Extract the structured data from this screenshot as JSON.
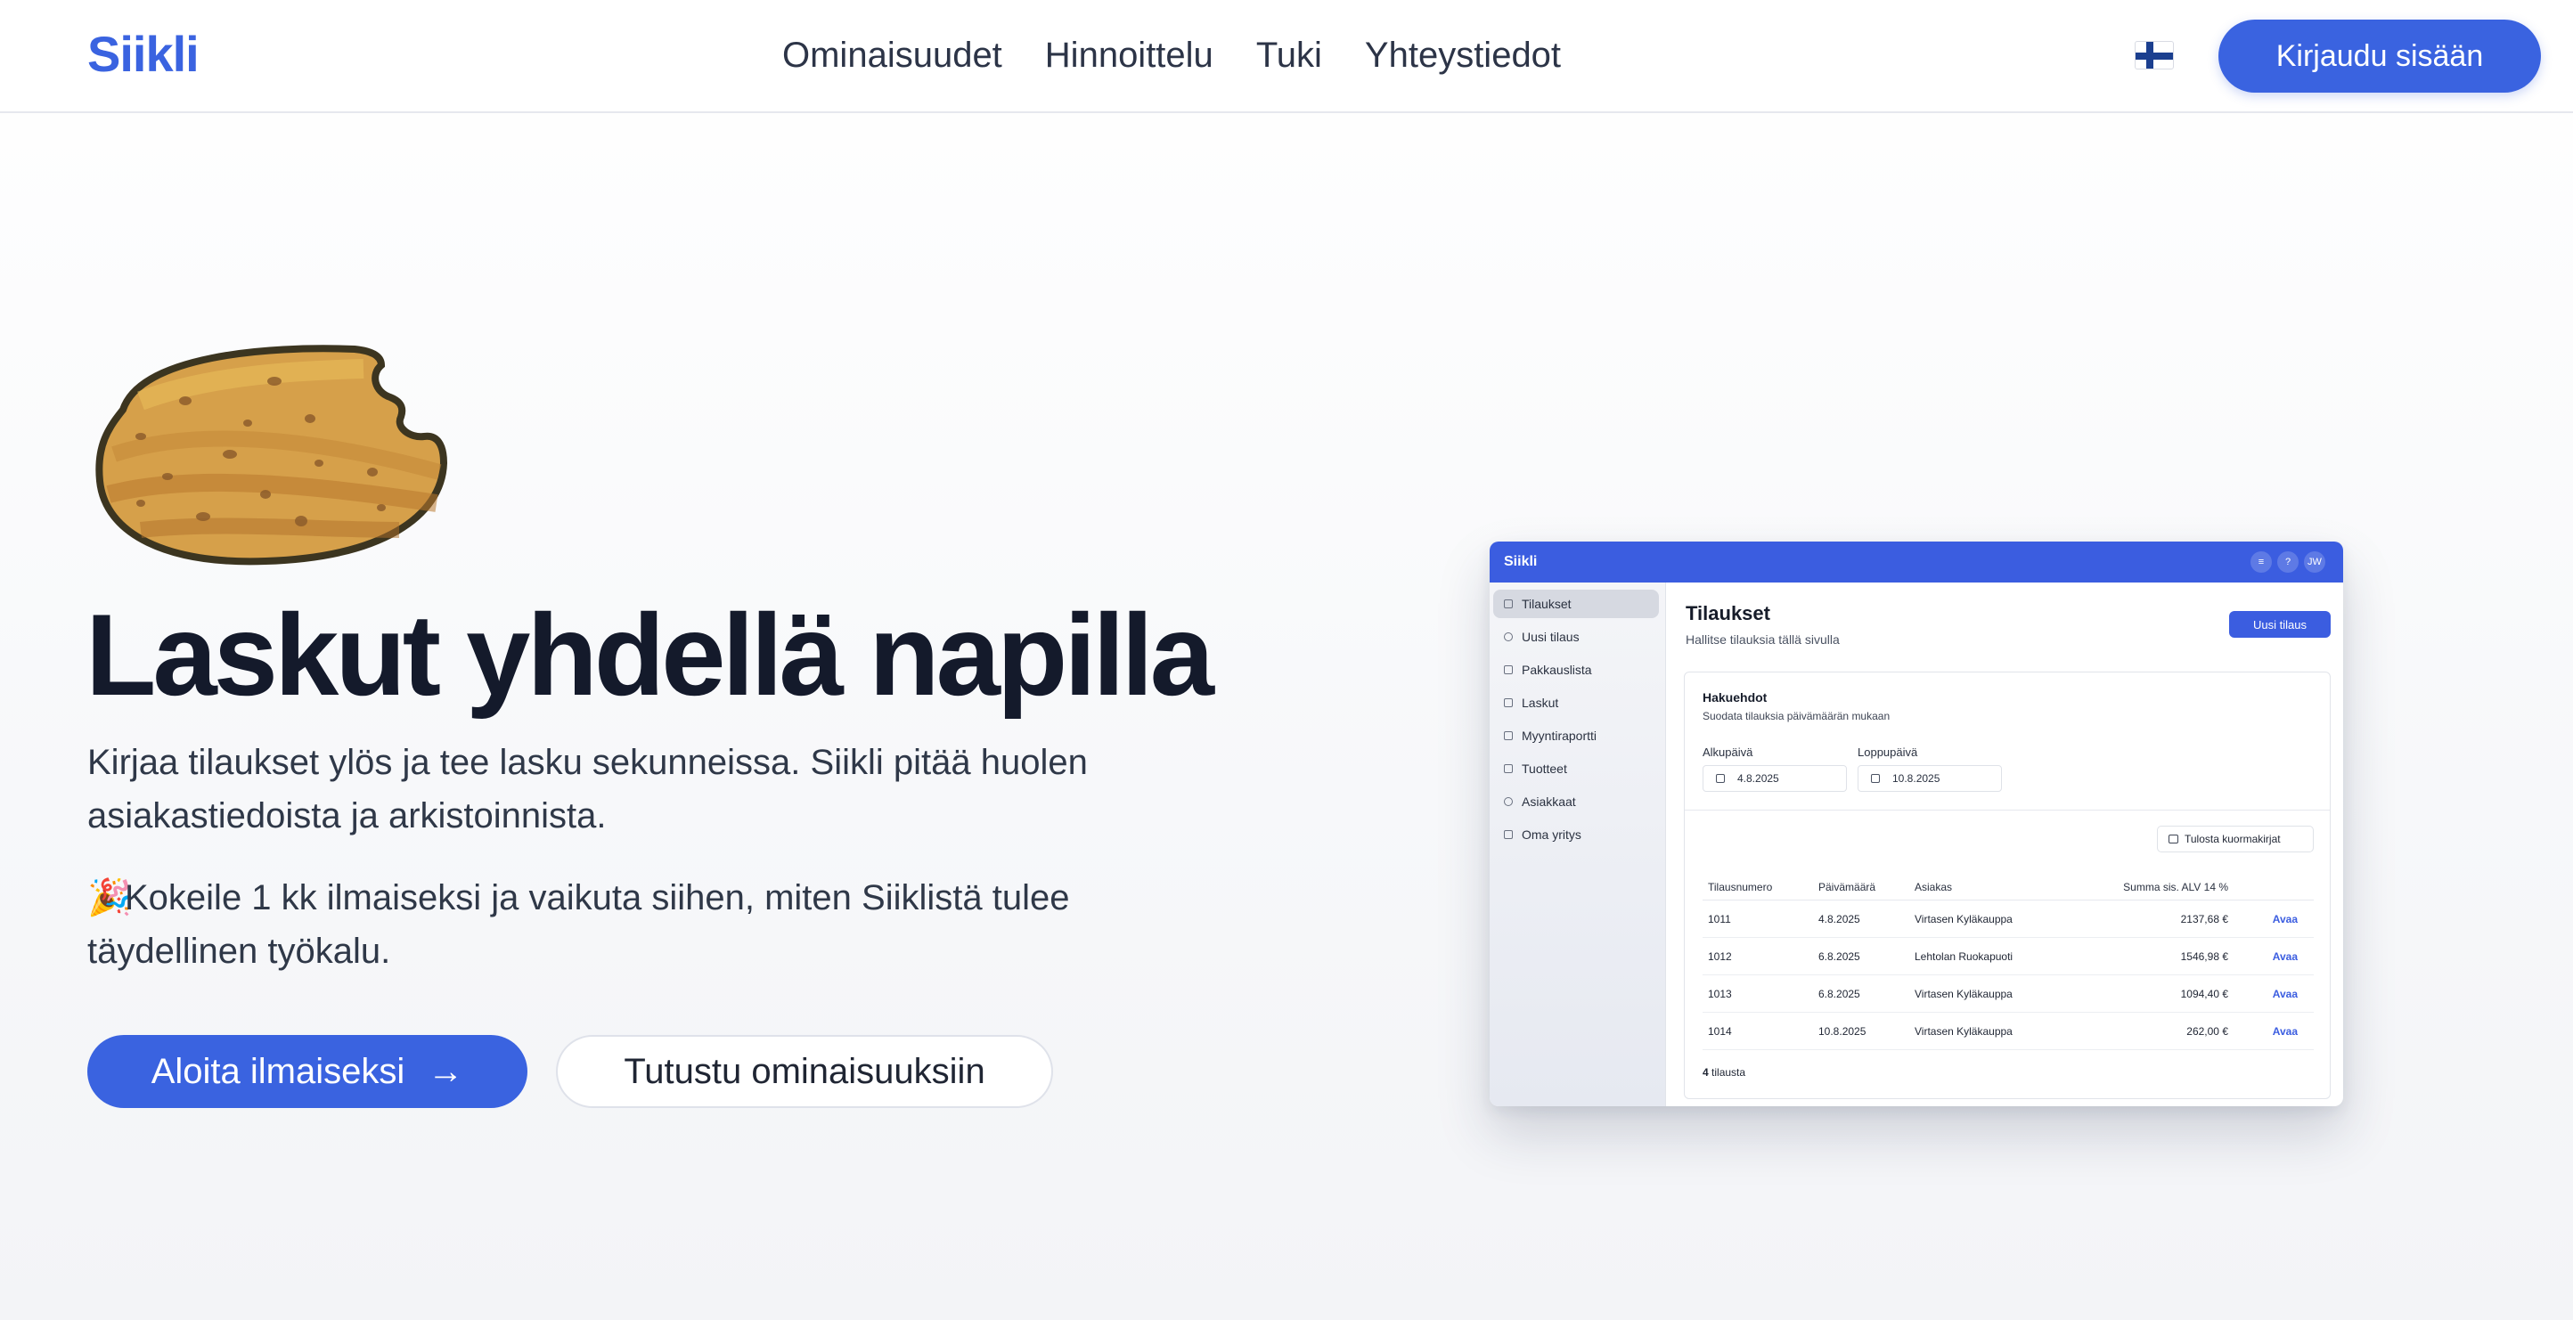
{
  "header": {
    "logo": "Siikli",
    "nav": [
      "Ominaisuudet",
      "Hinnoittelu",
      "Tuki",
      "Yhteystiedot"
    ],
    "language_icon": "finnish-flag-icon",
    "login_label": "Kirjaudu sisään"
  },
  "hero": {
    "mascot_icon": "bitten-potato-icon",
    "title": "Laskut yhdellä napilla",
    "text1": "Kirjaa tilaukset ylös ja tee lasku sekunneissa. Siikli pitää huolen asiakastiedoista ja arkistoinnista.",
    "text2_emoji": "🎉",
    "text2": "Kokeile 1 kk ilmaiseksi ja vaikuta siihen, miten Siiklistä tulee täydellinen työkalu.",
    "cta_primary": "Aloita ilmaiseksi",
    "cta_primary_icon": "→",
    "cta_secondary": "Tutustu ominaisuuksiin"
  },
  "preview": {
    "app_name": "Siikli",
    "user_initials": "JW",
    "sidebar": [
      "Tilaukset",
      "Uusi tilaus",
      "Pakkauslista",
      "Laskut",
      "Myyntiraportti",
      "Tuotteet",
      "Asiakkaat",
      "Oma yritys"
    ],
    "page_title": "Tilaukset",
    "page_subtitle": "Hallitse tilauksia tällä sivulla",
    "new_order_label": "Uusi tilaus",
    "filters": {
      "title": "Hakuehdot",
      "subtitle": "Suodata tilauksia päivämäärän mukaan",
      "start_label": "Alkupäivä",
      "start_value": "4.8.2025",
      "end_label": "Loppupäivä",
      "end_value": "10.8.2025"
    },
    "print_label": "Tulosta kuormakirjat",
    "table": {
      "headers": [
        "Tilausnumero",
        "Päivämäärä",
        "Asiakas",
        "Summa sis. ALV 14 %"
      ],
      "rows": [
        {
          "id": "1011",
          "date": "4.8.2025",
          "customer": "Virtasen Kyläkauppa",
          "sum": "2137,68 €",
          "action": "Avaa"
        },
        {
          "id": "1012",
          "date": "6.8.2025",
          "customer": "Lehtolan Ruokapuoti",
          "sum": "1546,98 €",
          "action": "Avaa"
        },
        {
          "id": "1013",
          "date": "6.8.2025",
          "customer": "Virtasen Kyläkauppa",
          "sum": "1094,40 €",
          "action": "Avaa"
        },
        {
          "id": "1014",
          "date": "10.8.2025",
          "customer": "Virtasen Kyläkauppa",
          "sum": "262,00 €",
          "action": "Avaa"
        }
      ]
    },
    "count_number": "4",
    "count_label": "tilausta"
  },
  "colors": {
    "brand": "#3a63e0",
    "title": "#141a2b",
    "text": "#2f3848"
  }
}
